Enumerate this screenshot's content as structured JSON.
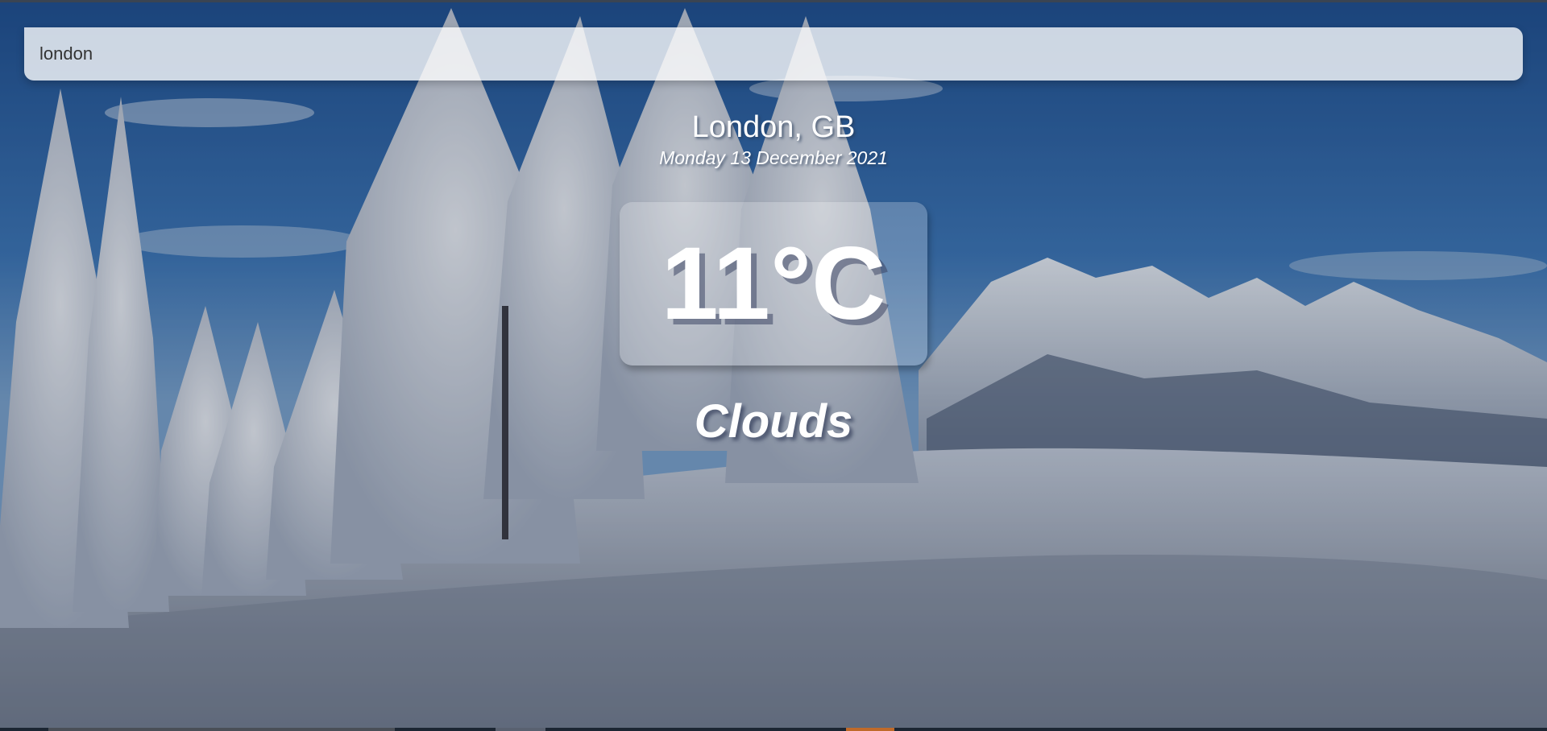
{
  "search": {
    "value": "london",
    "placeholder": ""
  },
  "location": {
    "text": "London, GB"
  },
  "date": {
    "text": "Monday 13 December 2021"
  },
  "weather": {
    "temperature": "11°C",
    "condition": "Clouds"
  },
  "colors": {
    "sky": "#2a5d9c",
    "snow": "#d8dde6",
    "text": "#ffffff"
  },
  "background": {
    "description_icon": "snowy-mountain-landscape"
  }
}
